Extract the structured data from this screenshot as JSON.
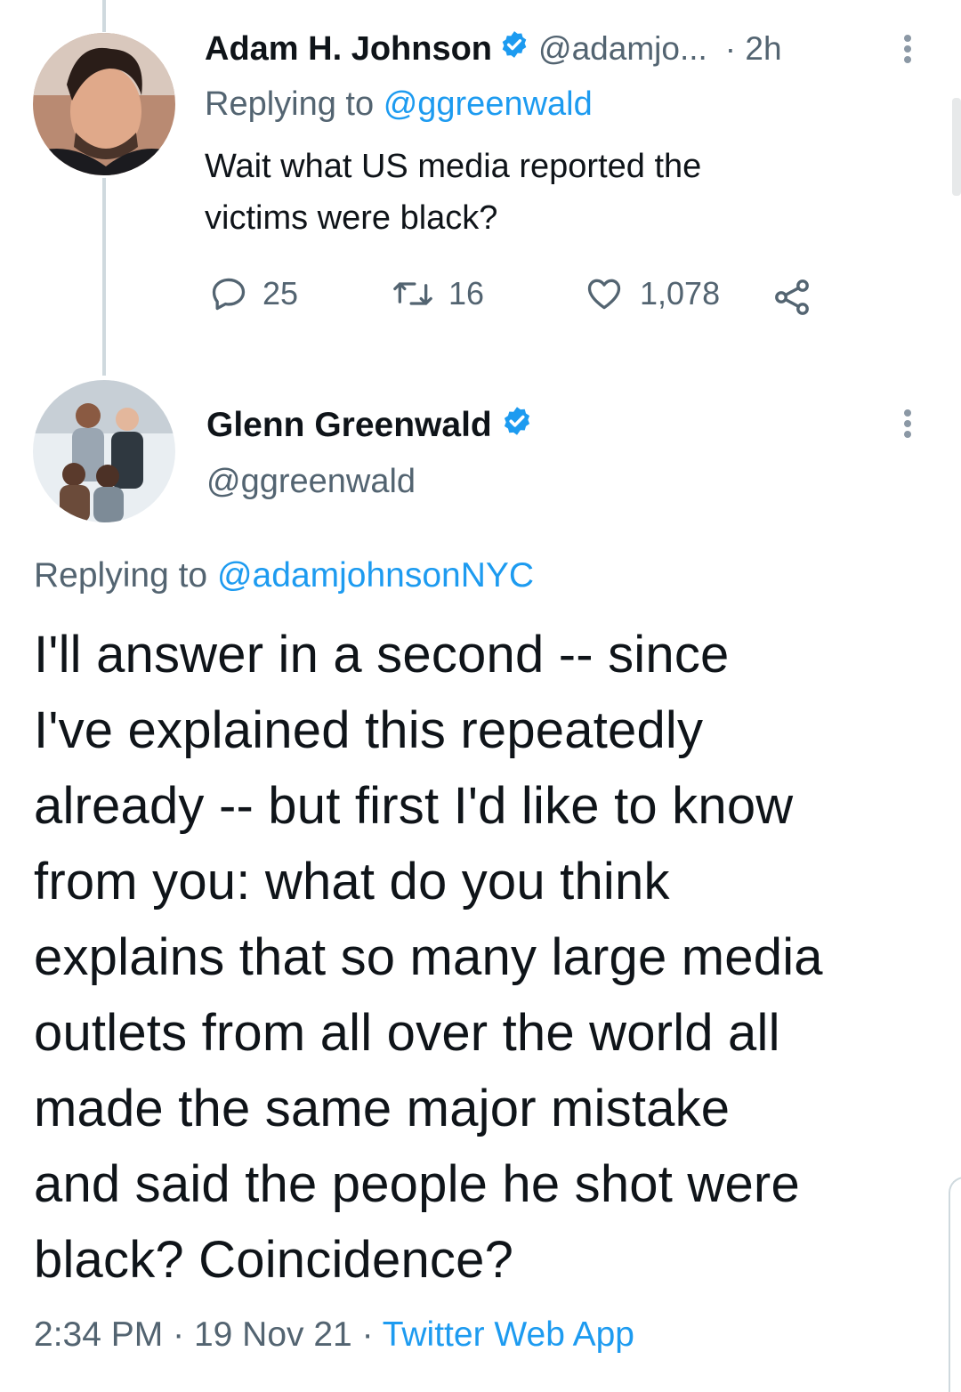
{
  "reply_tweet": {
    "author_name": "Adam H. Johnson",
    "handle": "@adamjo...",
    "time": "· 2h",
    "replying_prefix": "Replying to",
    "replying_handle": "@ggreenwald",
    "text_line1": "Wait what US media reported the",
    "text_line2": "victims were black?",
    "replies": "25",
    "retweets": "16",
    "likes": "1,078"
  },
  "main_tweet": {
    "author_name": "Glenn Greenwald",
    "handle": "@ggreenwald",
    "replying_prefix": "Replying to",
    "replying_handle": "@adamjohnsonNYC",
    "text": "I'll answer in a second -- since\nI've explained this repeatedly\nalready -- but first I'd like to know\nfrom you: what do you think\nexplains that so many large media\noutlets from all over the world all\nmade the same major mistake\nand said the people he shot were\nblack? Coincidence?",
    "time": "2:34 PM",
    "sep1": "·",
    "date": "19 Nov 21",
    "sep2": "·",
    "source": "Twitter Web App"
  },
  "icons": [
    "verified-badge-icon",
    "reply-icon",
    "retweet-icon",
    "like-icon",
    "share-icon",
    "more-icon"
  ],
  "colors": {
    "accent": "#1d9bf0",
    "text": "#0f1419",
    "muted": "#536471",
    "thread_line": "#cfd9de"
  }
}
